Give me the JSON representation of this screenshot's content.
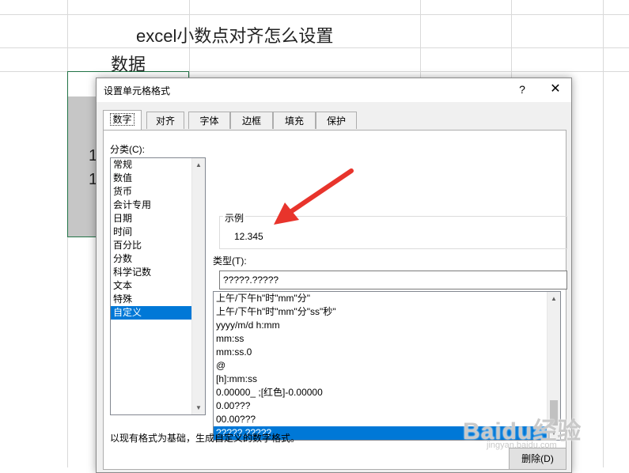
{
  "sheet": {
    "title": "excel小数点对齐怎么设置",
    "column_header": "数据",
    "peek_values": [
      "1",
      "1"
    ]
  },
  "dialog": {
    "title": "设置单元格格式",
    "help_label": "?",
    "close_label": "✕",
    "tabs": [
      {
        "label": "数字",
        "active": true
      },
      {
        "label": "对齐",
        "active": false
      },
      {
        "label": "字体",
        "active": false
      },
      {
        "label": "边框",
        "active": false
      },
      {
        "label": "填充",
        "active": false
      },
      {
        "label": "保护",
        "active": false
      }
    ],
    "category_label": "分类(C):",
    "categories": [
      "常规",
      "数值",
      "货币",
      "会计专用",
      "日期",
      "时间",
      "百分比",
      "分数",
      "科学记数",
      "文本",
      "特殊",
      "自定义"
    ],
    "selected_category": "自定义",
    "sample_label": "示例",
    "sample_value": "12.345",
    "type_label": "类型(T):",
    "type_value": "?????.?????",
    "formats": [
      "上午/下午h\"时\"mm\"分\"",
      "上午/下午h\"时\"mm\"分\"ss\"秒\"",
      "yyyy/m/d h:mm",
      "mm:ss",
      "mm:ss.0",
      "@",
      "[h]:mm:ss",
      "0.00000_ ;[红色]-0.00000",
      "0.00???",
      "00.00???",
      "?????.?????"
    ],
    "selected_format": "?????.?????",
    "delete_label": "删除(D)",
    "description": "以现有格式为基础，生成自定义的数字格式。"
  },
  "watermark": {
    "text": "Baidu经验",
    "sub": "jingyan.baidu.com"
  },
  "colors": {
    "selection": "#0078d7",
    "arrow": "#e8342c",
    "sheet_border": "#217346"
  }
}
